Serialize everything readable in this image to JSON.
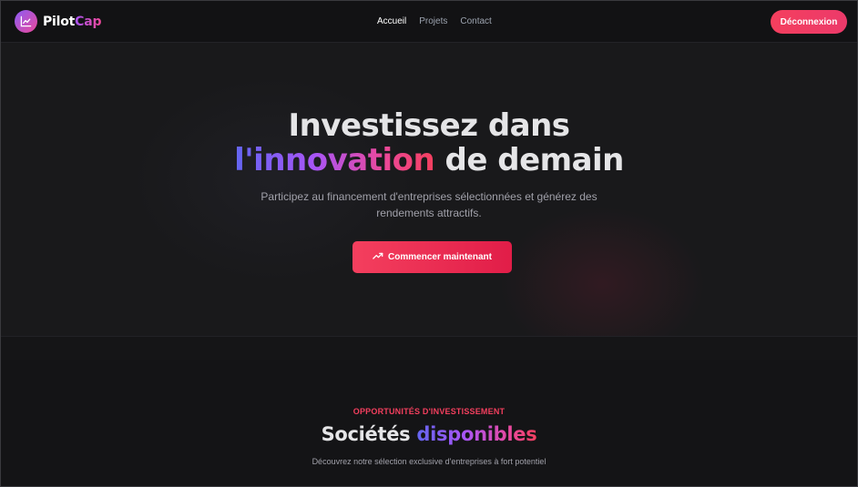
{
  "brand": {
    "name_part1": "Pilot",
    "name_part2": "Cap",
    "logo_icon": "chart-line-icon",
    "gradient": [
      "#8b5cf6",
      "#ec4899"
    ]
  },
  "nav": {
    "links": [
      {
        "label": "Accueil",
        "active": true
      },
      {
        "label": "Projets",
        "active": false
      },
      {
        "label": "Contact",
        "active": false
      }
    ],
    "logout_label": "Déconnexion"
  },
  "hero": {
    "title_line1": "Investissez dans",
    "title_highlight": "l'innovation",
    "title_rest": " de demain",
    "subtitle": "Participez au financement d'entreprises sélectionnées et générez des rendements attractifs.",
    "cta_label": "Commencer maintenant",
    "cta_icon": "trending-up-icon"
  },
  "section": {
    "eyebrow": "OPPORTUNITÉS D'INVESTISSEMENT",
    "title_plain": "Sociétés ",
    "title_highlight": "disponibles",
    "subtitle": "Découvrez notre sélection exclusive d'entreprises à fort potentiel"
  },
  "colors": {
    "accent": "#f43f5e",
    "background": "#161618",
    "text_primary": "#e5e5e7",
    "text_muted": "#a1a1aa"
  }
}
